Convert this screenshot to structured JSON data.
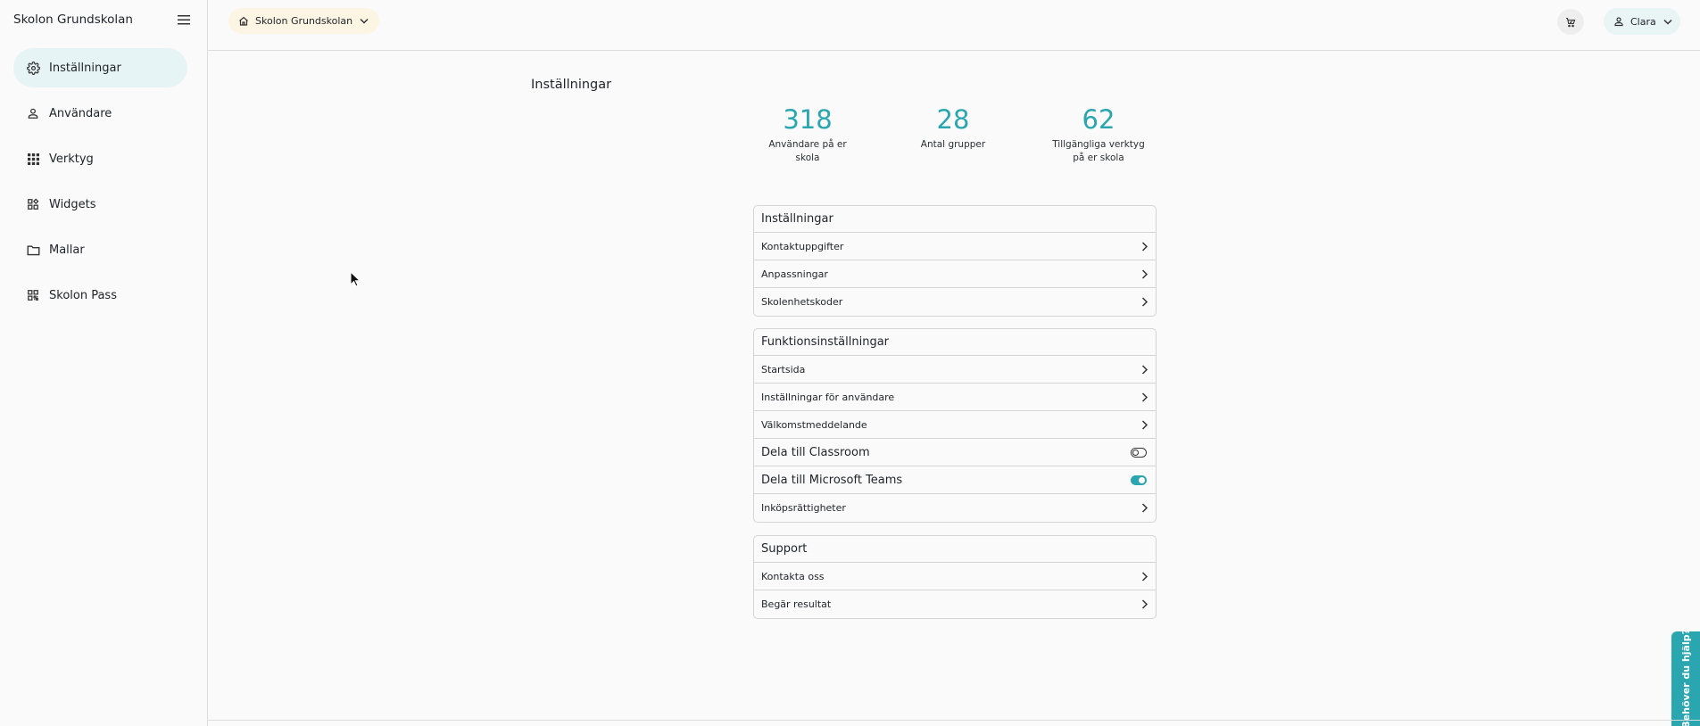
{
  "sidebar": {
    "brand": "Skolon Grundskolan",
    "items": [
      {
        "label": "Inställningar",
        "icon": "gear-icon",
        "active": true
      },
      {
        "label": "Användare",
        "icon": "person-icon",
        "active": false
      },
      {
        "label": "Verktyg",
        "icon": "apps-grid-icon",
        "active": false
      },
      {
        "label": "Widgets",
        "icon": "widgets-icon",
        "active": false
      },
      {
        "label": "Mallar",
        "icon": "folder-icon",
        "active": false
      },
      {
        "label": "Skolon Pass",
        "icon": "qr-code-icon",
        "active": false
      }
    ]
  },
  "topbar": {
    "school": "Skolon Grundskolan",
    "user": "Clara"
  },
  "main": {
    "title": "Inställningar",
    "stats": [
      {
        "value": "318",
        "label_line1": "Användare på er",
        "label_line2": "skola"
      },
      {
        "value": "28",
        "label_line1": "Antal grupper",
        "label_line2": ""
      },
      {
        "value": "62",
        "label_line1": "Tillgängliga verktyg",
        "label_line2": "på er skola"
      }
    ],
    "sections": [
      {
        "title": "Inställningar",
        "rows": [
          {
            "label": "Kontaktuppgifter"
          },
          {
            "label": "Anpassningar"
          },
          {
            "label": "Skolenhetskoder"
          }
        ]
      },
      {
        "title": "Funktionsinställningar",
        "rows": [
          {
            "label": "Startsida"
          },
          {
            "label": "Inställningar för användare"
          },
          {
            "label": "Välkomstmeddelande"
          },
          {
            "label": "Dela till Classroom",
            "toggle": false
          },
          {
            "label": "Dela till Microsoft Teams",
            "toggle": true
          },
          {
            "label": "Inköpsrättigheter"
          }
        ]
      },
      {
        "title": "Support",
        "rows": [
          {
            "label": "Kontakta oss"
          },
          {
            "label": "Begär resultat"
          }
        ]
      }
    ]
  },
  "help": {
    "label": "Behöver du hjälp?"
  },
  "colors": {
    "accent": "#2aa6b0",
    "active_nav_bg": "#e7f4f5",
    "school_pill_bg": "#fdf5e4"
  }
}
